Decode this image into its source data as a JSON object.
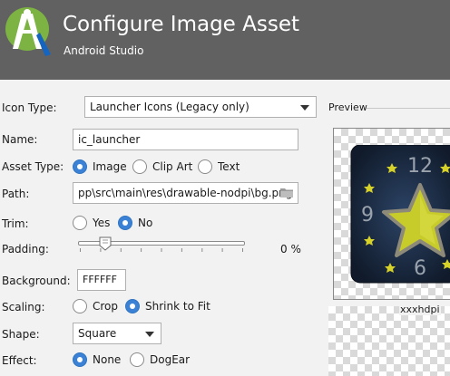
{
  "header": {
    "title": "Configure Image Asset",
    "subtitle": "Android Studio",
    "logo_icon": "android-studio-logo-icon"
  },
  "form": {
    "icon_type": {
      "label": "Icon Type:",
      "value": "Launcher Icons (Legacy only)"
    },
    "name": {
      "label": "Name:",
      "value": "ic_launcher"
    },
    "asset_type": {
      "label": "Asset Type:",
      "options": [
        "Image",
        "Clip Art",
        "Text"
      ],
      "selected": "Image"
    },
    "path": {
      "label": "Path:",
      "value": "pp\\src\\main\\res\\drawable-nodpi\\bg.png",
      "icon": "folder-icon"
    },
    "trim": {
      "label": "Trim:",
      "options": [
        "Yes",
        "No"
      ],
      "selected": "No"
    },
    "padding": {
      "label": "Padding:",
      "value_text": "0 %",
      "value": 0
    },
    "background": {
      "label": "Background:",
      "value": "FFFFFF"
    },
    "scaling": {
      "label": "Scaling:",
      "options": [
        "Crop",
        "Shrink to Fit"
      ],
      "selected": "Shrink to Fit"
    },
    "shape": {
      "label": "Shape:",
      "value": "Square"
    },
    "effect": {
      "label": "Effect:",
      "options": [
        "None",
        "DogEar"
      ],
      "selected": "None"
    }
  },
  "preview": {
    "label": "Preview",
    "density": "xxxhdpi",
    "clock_numbers": [
      "12",
      "9",
      "6"
    ]
  },
  "colors": {
    "header_bg": "#616161",
    "radio_selected": "#3b82d6",
    "clock_bg": "#1c2a40",
    "star": "#c8cc2a"
  }
}
